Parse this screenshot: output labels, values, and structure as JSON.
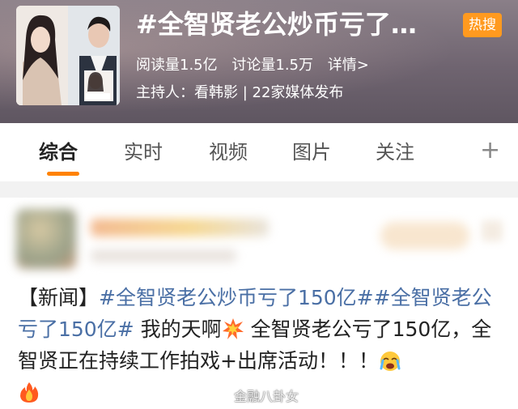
{
  "header": {
    "hashtag": "#全智贤老公炒币亏了…",
    "hot_badge": "热搜",
    "read_count": "阅读量1.5亿",
    "discuss_count": "讨论量1.5万",
    "details_link": "详情>",
    "host": "主持人：看韩影 | 22家媒体发布",
    "thumbnail_icon": "topic-thumbnail-photo"
  },
  "tabs": {
    "items": [
      "综合",
      "实时",
      "视频",
      "图片",
      "关注"
    ],
    "active_index": 0,
    "add_icon": "+"
  },
  "post": {
    "prefix": "【新闻】",
    "topic1": "#全智贤老公炒币亏了150亿#",
    "topic2": "#全智贤老公亏了150亿#",
    "text1": " 我的天啊",
    "text2": " 全智贤老公亏了150亿，全智贤正在持续工作拍戏+出席活动！！！",
    "emoji_names": [
      "collision-emoji",
      "crying-face-emoji",
      "fire-emoji"
    ]
  },
  "watermark": {
    "text": "金融八卦女",
    "icon": "weibo-logo-icon"
  },
  "colors": {
    "accent": "#ff8200",
    "hot_badge": "#ff9a1f",
    "topic_link": "#4a6fa5"
  }
}
